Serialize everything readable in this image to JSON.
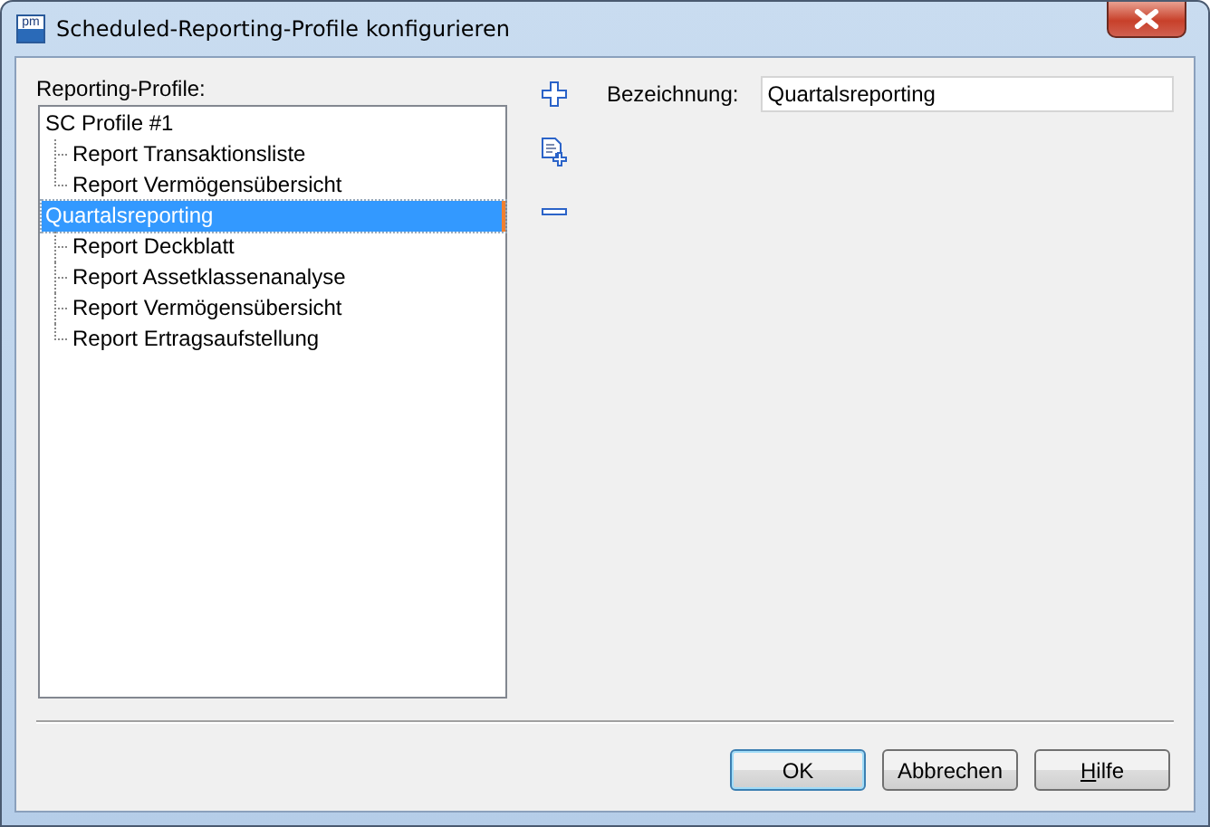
{
  "window": {
    "title": "Scheduled-Reporting-Profile konfigurieren",
    "app_badge": "pm"
  },
  "profiles": {
    "label": "Reporting-Profile:",
    "items": [
      {
        "label": "SC Profile #1",
        "selected": false,
        "children": [
          {
            "label": "Report Transaktionsliste",
            "selected": false
          },
          {
            "label": "Report Vermögensübersicht",
            "selected": false
          }
        ]
      },
      {
        "label": "Quartalsreporting",
        "selected": true,
        "children": [
          {
            "label": "Report Deckblatt",
            "selected": false
          },
          {
            "label": "Report Assetklassenanalyse",
            "selected": false
          },
          {
            "label": "Report Vermögensübersicht",
            "selected": false
          },
          {
            "label": "Report Ertragsaufstellung",
            "selected": false
          }
        ]
      }
    ]
  },
  "name_field": {
    "label": "Bezeichnung:",
    "value": "Quartalsreporting"
  },
  "buttons": [
    {
      "label": "OK",
      "first_letter_underlined": false,
      "default": true
    },
    {
      "label": "Abbrechen",
      "first_letter_underlined": false,
      "default": false
    },
    {
      "label": "Hilfe",
      "first_letter_underlined": true,
      "default": false
    }
  ]
}
